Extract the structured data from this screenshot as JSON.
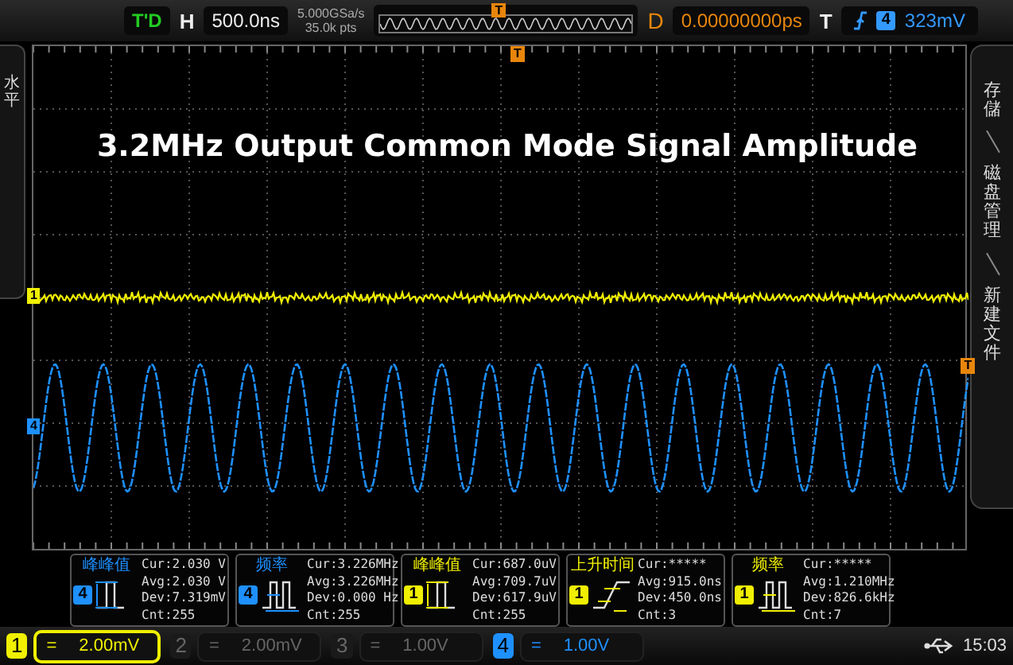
{
  "top_bar": {
    "status": "T'D",
    "horizontal_label": "H",
    "timebase": "500.0ns",
    "sample_rate": "5.000GSa/s",
    "memory_depth": "35.0k pts",
    "overview_marker": "T",
    "delay_label": "D",
    "delay": "0.00000000ps",
    "trigger_label": "T",
    "trigger_source": "4",
    "trigger_level": "323mV"
  },
  "left_menu": {
    "label": "水平"
  },
  "right_menu": {
    "items": [
      "存儲",
      "磁盘管理",
      "新建文件"
    ]
  },
  "screen": {
    "title": "3.2MHz Output Common Mode Signal Amplitude",
    "trigger_marker": "T",
    "level_marker": "T",
    "traces": [
      {
        "channel": "1",
        "kind": "noise",
        "color": "#f0f000"
      },
      {
        "channel": "4",
        "kind": "sine",
        "color": "#1e90ff"
      }
    ]
  },
  "measurements": [
    {
      "title": "峰峰值",
      "channel": "4",
      "kind": "pulse",
      "color": "#1e90ff",
      "lines": [
        "Cur:2.030 V",
        "Avg:2.030 V",
        "Dev:7.319mV",
        "Cnt:255"
      ]
    },
    {
      "title": "频率",
      "channel": "4",
      "kind": "period",
      "color": "#1e90ff",
      "lines": [
        "Cur:3.226MHz",
        "Avg:3.226MHz",
        "Dev:0.000 Hz",
        "Cnt:255"
      ]
    },
    {
      "title": "峰峰值",
      "channel": "1",
      "kind": "pulse",
      "color": "#f0f000",
      "lines": [
        "Cur:687.0uV",
        "Avg:709.7uV",
        "Dev:617.9uV",
        "Cnt:255"
      ]
    },
    {
      "title": "上升时间",
      "channel": "1",
      "kind": "rise",
      "color": "#f0f000",
      "lines": [
        "Cur:*****",
        "Avg:915.0ns",
        "Dev:450.0ns",
        "Cnt:3"
      ]
    },
    {
      "title": "频率",
      "channel": "1",
      "kind": "period",
      "color": "#f0f000",
      "lines": [
        "Cur:*****",
        "Avg:1.210MHz",
        "Dev:826.6kHz",
        "Cnt:7"
      ]
    }
  ],
  "channels": [
    {
      "number": "1",
      "coupling": "=",
      "scale": "2.00mV",
      "on": true,
      "selected": true,
      "color": "#f0f000"
    },
    {
      "number": "2",
      "coupling": "=",
      "scale": "2.00mV",
      "on": false,
      "selected": false
    },
    {
      "number": "3",
      "coupling": "=",
      "scale": "1.00V",
      "on": false,
      "selected": false
    },
    {
      "number": "4",
      "coupling": "=",
      "scale": "1.00V",
      "on": true,
      "selected": false,
      "color": "#1e90ff"
    }
  ],
  "status_bar": {
    "time": "15:03"
  }
}
